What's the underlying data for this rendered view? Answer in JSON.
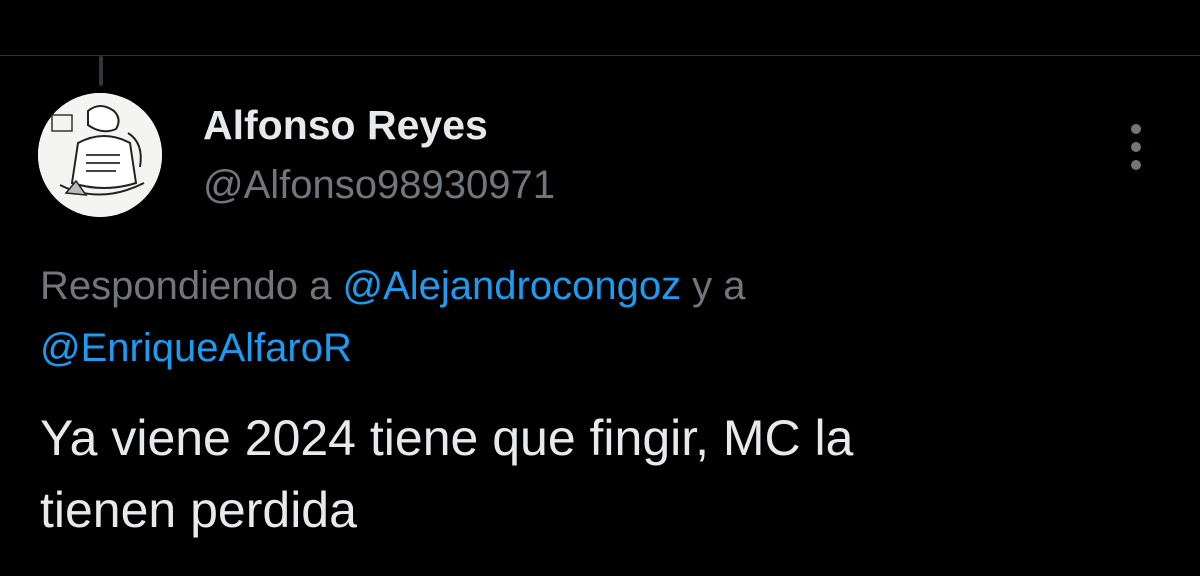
{
  "tweet": {
    "author": {
      "display_name": "Alfonso Reyes",
      "handle": "@Alfonso98930971"
    },
    "reply_context": {
      "prefix": "Respondiendo a ",
      "mentions": [
        "@Alejandrocongoz",
        "@EnriqueAlfaroR"
      ],
      "connector": " y a"
    },
    "text_lines": [
      "Ya viene 2024 tiene que fingir, MC la",
      "tienen perdida"
    ]
  },
  "icons": {
    "more": "more-vertical-icon"
  },
  "colors": {
    "background": "#000000",
    "primary_text": "#e7e9ea",
    "secondary_text": "#71767b",
    "link": "#1d9bf0"
  }
}
